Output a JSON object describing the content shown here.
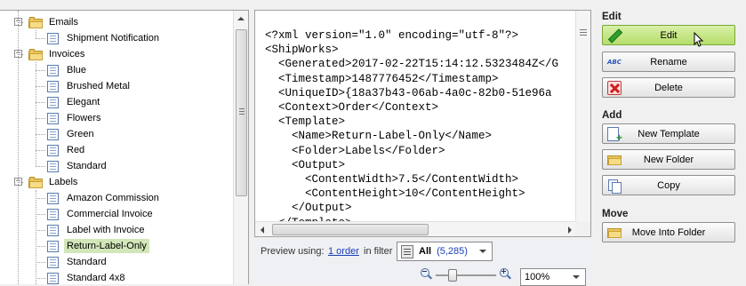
{
  "tree": {
    "items": [
      {
        "label": "Emails",
        "type": "folder",
        "level": 1,
        "expanded": true
      },
      {
        "label": "Shipment Notification",
        "type": "template",
        "level": 2
      },
      {
        "label": "Invoices",
        "type": "folder",
        "level": 1,
        "expanded": true
      },
      {
        "label": "Blue",
        "type": "template",
        "level": 2
      },
      {
        "label": "Brushed Metal",
        "type": "template",
        "level": 2
      },
      {
        "label": "Elegant",
        "type": "template",
        "level": 2
      },
      {
        "label": "Flowers",
        "type": "template",
        "level": 2
      },
      {
        "label": "Green",
        "type": "template",
        "level": 2
      },
      {
        "label": "Red",
        "type": "template",
        "level": 2
      },
      {
        "label": "Standard",
        "type": "template",
        "level": 2
      },
      {
        "label": "Labels",
        "type": "folder",
        "level": 1,
        "expanded": true
      },
      {
        "label": "Amazon Commission",
        "type": "template",
        "level": 2
      },
      {
        "label": "Commercial Invoice",
        "type": "template",
        "level": 2
      },
      {
        "label": "Label with Invoice",
        "type": "template",
        "level": 2
      },
      {
        "label": "Return-Label-Only",
        "type": "template",
        "level": 2,
        "selected": true
      },
      {
        "label": "Standard",
        "type": "template",
        "level": 2
      },
      {
        "label": "Standard 4x8",
        "type": "template",
        "level": 2
      }
    ]
  },
  "xml_preview": {
    "lines": [
      "<?xml version=\"1.0\" encoding=\"utf-8\"?>",
      "<ShipWorks>",
      "  <Generated>2017-02-22T15:14:12.5323484Z</G",
      "  <Timestamp>1487776452</Timestamp>",
      "  <UniqueID>{18a37b43-06ab-4a0c-82b0-51e96a",
      "  <Context>Order</Context>",
      "  <Template>",
      "    <Name>Return-Label-Only</Name>",
      "    <Folder>Labels</Folder>",
      "    <Output>",
      "      <ContentWidth>7.5</ContentWidth>",
      "      <ContentHeight>10</ContentHeight>",
      "    </Output>",
      "  </Template>"
    ]
  },
  "preview": {
    "label": "Preview using:",
    "order_link": "1 order",
    "filter_text": "in filter",
    "filter_name": "All",
    "filter_count": "(5,285)",
    "zoom_value": "100%"
  },
  "actions": {
    "edit_title": "Edit",
    "edit_label": "Edit",
    "rename_label": "Rename",
    "delete_label": "Delete",
    "add_title": "Add",
    "new_template_label": "New Template",
    "new_folder_label": "New Folder",
    "copy_label": "Copy",
    "move_title": "Move",
    "move_into_folder_label": "Move Into Folder"
  },
  "icons": {
    "folder": "folder-icon",
    "template": "document-icon",
    "edit": "pencil-icon",
    "rename": "abc-icon",
    "delete": "red-x-icon",
    "new_template": "new-document-icon",
    "new_folder": "new-folder-icon",
    "copy": "copy-icon",
    "move": "move-folder-icon",
    "zoom_out": "zoom-out-icon",
    "zoom_in": "zoom-in-icon"
  },
  "colors": {
    "selection": "#d2e6b9",
    "highlight_button": "#b6dd6a",
    "link": "#1a3db8"
  }
}
